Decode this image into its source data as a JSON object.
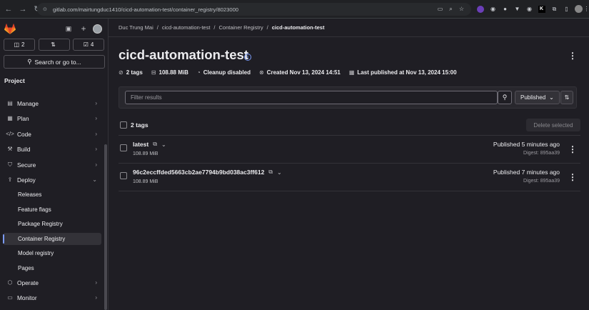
{
  "browser": {
    "url": "gitlab.com/mairtungduc1410/cicd-automation-test/container_registry/8023000"
  },
  "sidebar": {
    "counters": [
      {
        "icon": "issues-icon",
        "count": "2"
      },
      {
        "icon": "merge-request-icon",
        "count": ""
      },
      {
        "icon": "todo-icon",
        "count": "4"
      }
    ],
    "search_label": "Search or go to...",
    "section_title": "Project",
    "items": [
      {
        "label": "Manage",
        "icon": "manage-icon"
      },
      {
        "label": "Plan",
        "icon": "plan-icon"
      },
      {
        "label": "Code",
        "icon": "code-icon"
      },
      {
        "label": "Build",
        "icon": "build-icon"
      },
      {
        "label": "Secure",
        "icon": "shield-icon"
      },
      {
        "label": "Deploy",
        "icon": "deploy-icon"
      }
    ],
    "deploy_subitems": [
      {
        "label": "Releases"
      },
      {
        "label": "Feature flags"
      },
      {
        "label": "Package Registry"
      },
      {
        "label": "Container Registry"
      },
      {
        "label": "Model registry"
      },
      {
        "label": "Pages"
      }
    ],
    "bottom_items": [
      {
        "label": "Operate",
        "icon": "operate-icon"
      },
      {
        "label": "Monitor",
        "icon": "monitor-icon"
      }
    ]
  },
  "breadcrumb": {
    "items": [
      "Duc Trung Mai",
      "cicd-automation-test",
      "Container Registry",
      "cicd-automation-test"
    ],
    "separator": "/"
  },
  "page": {
    "title": "cicd-automation-test",
    "meta": {
      "tags": "2 tags",
      "size": "108.88 MiB",
      "cleanup": "Cleanup disabled",
      "created": "Created Nov 13, 2024 14:51",
      "published": "Last published at Nov 13, 2024 15:00"
    }
  },
  "filter": {
    "placeholder": "Filter results",
    "sort_label": "Published"
  },
  "list": {
    "count_label": "2 tags",
    "delete_label": "Delete selected",
    "rows": [
      {
        "name": "latest",
        "size": "108.89 MiB",
        "published": "Published 5 minutes ago",
        "digest": "Digest: 895aa39"
      },
      {
        "name": "96c2eccffded5663cb2ae7794b9bd038ac3ff612",
        "size": "108.89 MiB",
        "published": "Published 7 minutes ago",
        "digest": "Digest: 895aa39"
      }
    ]
  },
  "colors": {
    "background": "#1f1e24",
    "accent": "#7b9bf7",
    "gitlab_orange": "#fc6d26"
  }
}
